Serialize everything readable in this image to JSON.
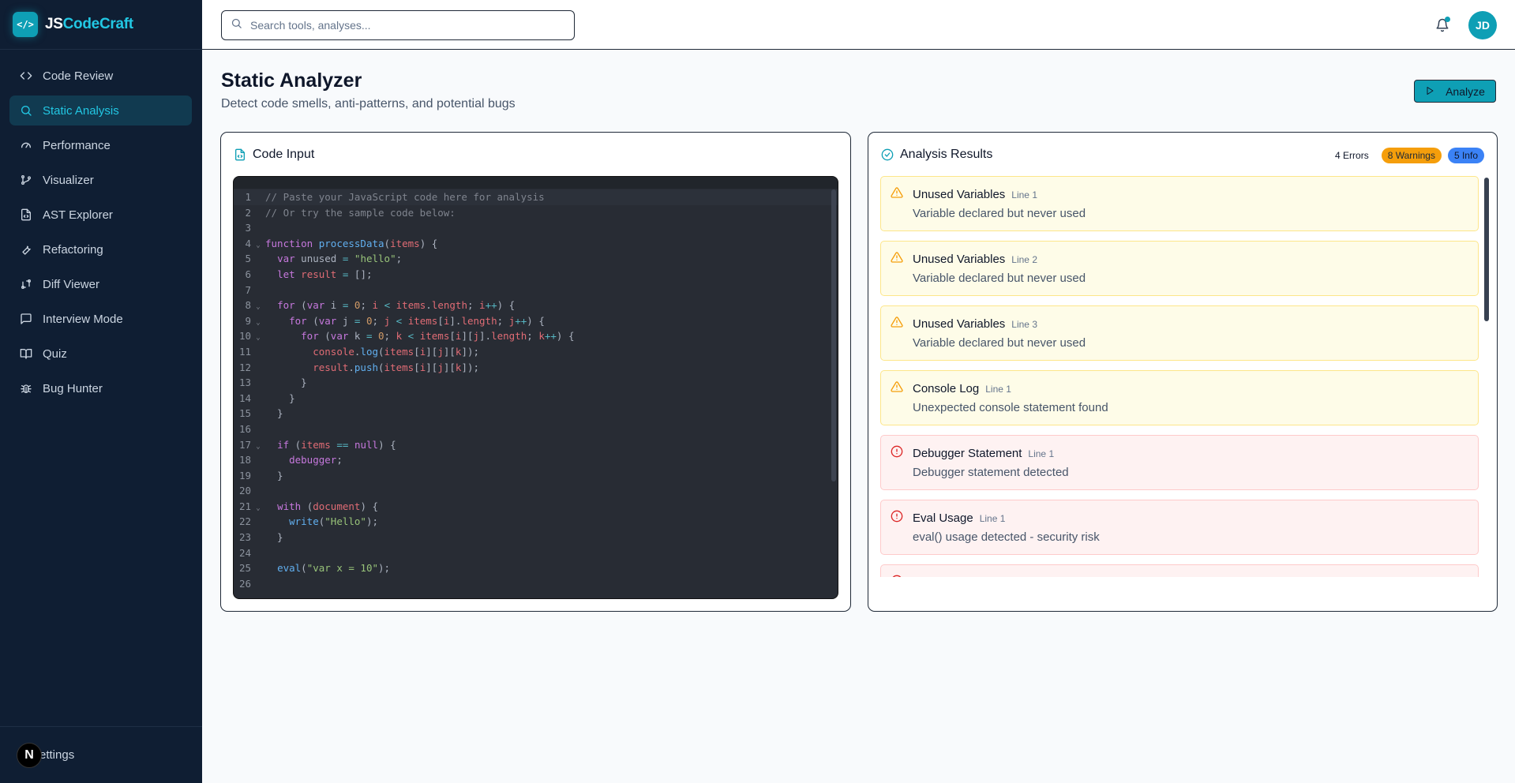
{
  "brand": {
    "logo_glyph": "</>",
    "js": "JS",
    "rest": "CodeCraft"
  },
  "nav": [
    {
      "label": "Code Review",
      "icon": "code-icon",
      "active": false
    },
    {
      "label": "Static Analysis",
      "icon": "search-icon",
      "active": true
    },
    {
      "label": "Performance",
      "icon": "gauge-icon",
      "active": false
    },
    {
      "label": "Visualizer",
      "icon": "git-branch-icon",
      "active": false
    },
    {
      "label": "AST Explorer",
      "icon": "file-code-icon",
      "active": false
    },
    {
      "label": "Refactoring",
      "icon": "wrench-icon",
      "active": false
    },
    {
      "label": "Diff Viewer",
      "icon": "git-compare-icon",
      "active": false
    },
    {
      "label": "Interview Mode",
      "icon": "message-square-icon",
      "active": false
    },
    {
      "label": "Quiz",
      "icon": "book-open-icon",
      "active": false
    },
    {
      "label": "Bug Hunter",
      "icon": "bug-icon",
      "active": false
    }
  ],
  "footer": {
    "badge": "N",
    "settings": "Settings"
  },
  "search": {
    "placeholder": "Search tools, analyses..."
  },
  "user": {
    "initials": "JD"
  },
  "page": {
    "title": "Static Analyzer",
    "subtitle": "Detect code smells, anti-patterns, and potential bugs",
    "analyze_label": "Analyze"
  },
  "code_card": {
    "title": "Code Input"
  },
  "results_card": {
    "title": "Analysis Results",
    "errors": "4 Errors",
    "warnings": "8 Warnings",
    "info": "5 Info"
  },
  "code_lines": [
    {
      "n": "1",
      "fold": "",
      "text": "// Paste your JavaScript code here for analysis"
    },
    {
      "n": "2",
      "fold": "",
      "text": "// Or try the sample code below:"
    },
    {
      "n": "3",
      "fold": "",
      "text": ""
    },
    {
      "n": "4",
      "fold": "⌄",
      "text": "function processData(items) {"
    },
    {
      "n": "5",
      "fold": "",
      "text": "  var unused = \"hello\";"
    },
    {
      "n": "6",
      "fold": "",
      "text": "  let result = [];"
    },
    {
      "n": "7",
      "fold": "",
      "text": ""
    },
    {
      "n": "8",
      "fold": "⌄",
      "text": "  for (var i = 0; i < items.length; i++) {"
    },
    {
      "n": "9",
      "fold": "⌄",
      "text": "    for (var j = 0; j < items[i].length; j++) {"
    },
    {
      "n": "10",
      "fold": "⌄",
      "text": "      for (var k = 0; k < items[i][j].length; k++) {"
    },
    {
      "n": "11",
      "fold": "",
      "text": "        console.log(items[i][j][k]);"
    },
    {
      "n": "12",
      "fold": "",
      "text": "        result.push(items[i][j][k]);"
    },
    {
      "n": "13",
      "fold": "",
      "text": "      }"
    },
    {
      "n": "14",
      "fold": "",
      "text": "    }"
    },
    {
      "n": "15",
      "fold": "",
      "text": "  }"
    },
    {
      "n": "16",
      "fold": "",
      "text": ""
    },
    {
      "n": "17",
      "fold": "⌄",
      "text": "  if (items == null) {"
    },
    {
      "n": "18",
      "fold": "",
      "text": "    debugger;"
    },
    {
      "n": "19",
      "fold": "",
      "text": "  }"
    },
    {
      "n": "20",
      "fold": "",
      "text": ""
    },
    {
      "n": "21",
      "fold": "⌄",
      "text": "  with (document) {"
    },
    {
      "n": "22",
      "fold": "",
      "text": "    write(\"Hello\");"
    },
    {
      "n": "23",
      "fold": "",
      "text": "  }"
    },
    {
      "n": "24",
      "fold": "",
      "text": ""
    },
    {
      "n": "25",
      "fold": "",
      "text": "  eval(\"var x = 10\");"
    },
    {
      "n": "26",
      "fold": "",
      "text": ""
    }
  ],
  "issues": [
    {
      "severity": "warning",
      "icon": "alert-triangle-icon",
      "title": "Unused Variables",
      "line": "Line 1",
      "desc": "Variable declared but never used"
    },
    {
      "severity": "warning",
      "icon": "alert-triangle-icon",
      "title": "Unused Variables",
      "line": "Line 2",
      "desc": "Variable declared but never used"
    },
    {
      "severity": "warning",
      "icon": "alert-triangle-icon",
      "title": "Unused Variables",
      "line": "Line 3",
      "desc": "Variable declared but never used"
    },
    {
      "severity": "warning",
      "icon": "alert-triangle-icon",
      "title": "Console Log",
      "line": "Line 1",
      "desc": "Unexpected console statement found"
    },
    {
      "severity": "error",
      "icon": "alert-circle-icon",
      "title": "Debugger Statement",
      "line": "Line 1",
      "desc": "Debugger statement detected"
    },
    {
      "severity": "error",
      "icon": "alert-circle-icon",
      "title": "Eval Usage",
      "line": "Line 1",
      "desc": "eval() usage detected - security risk"
    },
    {
      "severity": "error",
      "icon": "alert-circle-icon",
      "title": "",
      "line": "",
      "desc": ""
    }
  ],
  "colors": {
    "accent": "#0e9fb5",
    "sidebar_bg": "#0f1e33",
    "warning": "#f59e0b",
    "info": "#3b82f6",
    "error": "#dc2626"
  }
}
